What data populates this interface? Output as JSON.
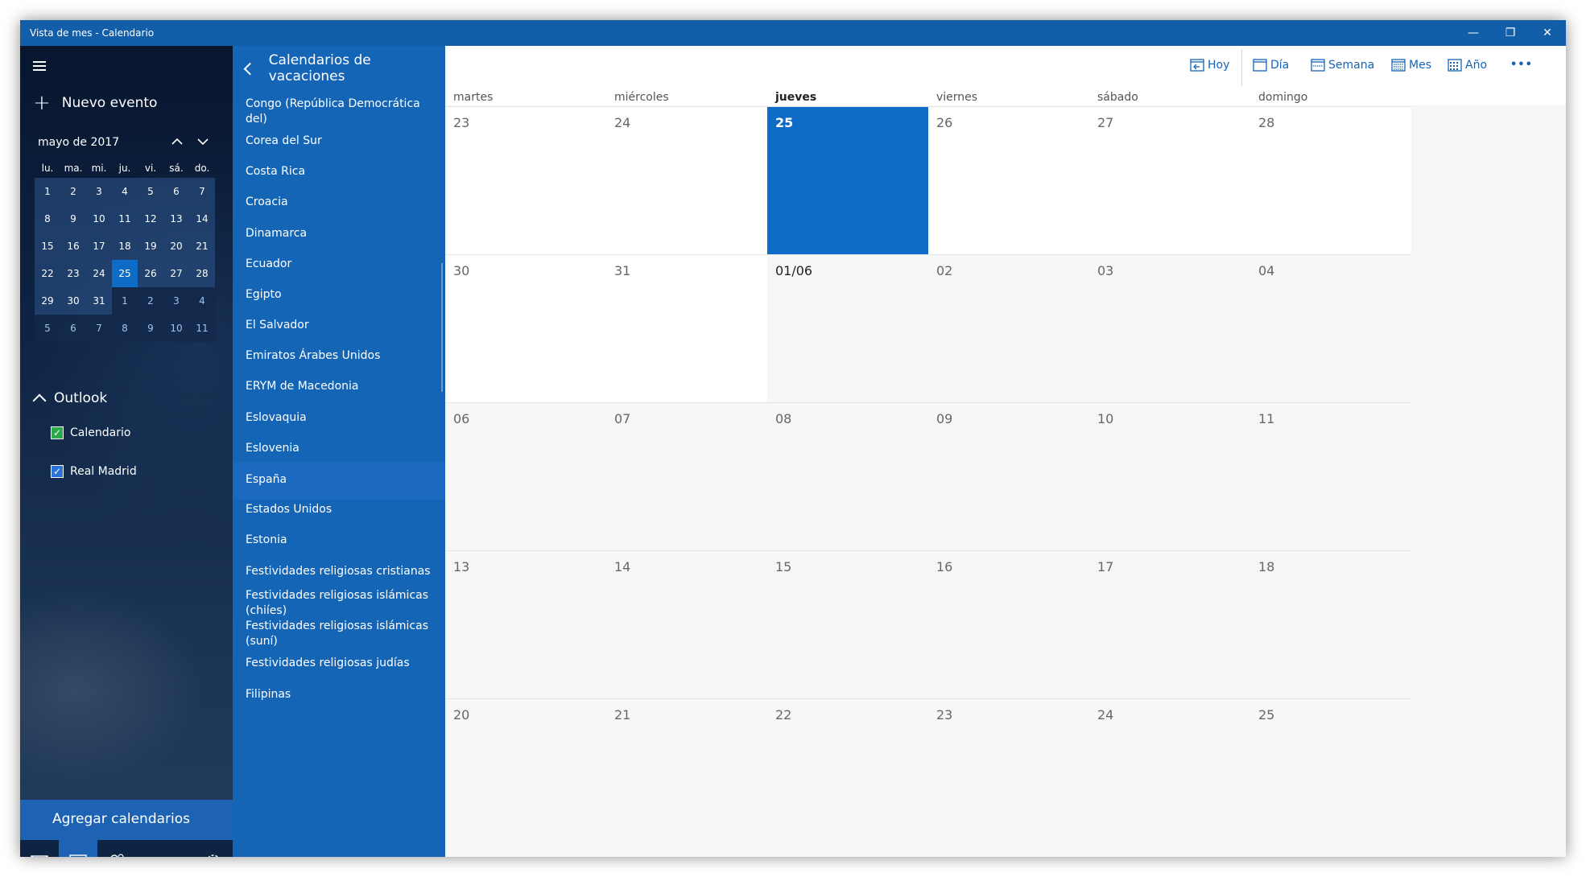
{
  "window": {
    "title": "Vista de mes - Calendario",
    "minimize": "—",
    "maximize": "❐",
    "close": "✕"
  },
  "sidebar": {
    "new_event": "Nuevo evento",
    "month_label": "mayo de 2017",
    "weekdays": [
      "lu.",
      "ma.",
      "mi.",
      "ju.",
      "vi.",
      "sá.",
      "do."
    ],
    "days": [
      [
        "1",
        "2",
        "3",
        "4",
        "5",
        "6",
        "7"
      ],
      [
        "8",
        "9",
        "10",
        "11",
        "12",
        "13",
        "14"
      ],
      [
        "15",
        "16",
        "17",
        "18",
        "19",
        "20",
        "21"
      ],
      [
        "22",
        "23",
        "24",
        "25",
        "26",
        "27",
        "28"
      ],
      [
        "29",
        "30",
        "31",
        "1",
        "2",
        "3",
        "4"
      ],
      [
        "5",
        "6",
        "7",
        "8",
        "9",
        "10",
        "11"
      ]
    ],
    "section_title": "Outlook",
    "calendars": [
      {
        "label": "Calendario",
        "color": "#2ba84a"
      },
      {
        "label": "Real Madrid",
        "color": "#2a73d9"
      }
    ],
    "add_calendars": "Agregar calendarios"
  },
  "holidays": {
    "title": "Calendarios de vacaciones",
    "items": [
      "Congo (República Democrática del)",
      "Corea del Sur",
      "Costa Rica",
      "Croacia",
      "Dinamarca",
      "Ecuador",
      "Egipto",
      "El Salvador",
      "Emiratos Árabes Unidos",
      "ERYM de Macedonia",
      "Eslovaquia",
      "Eslovenia",
      "España",
      "Estados Unidos",
      "Estonia",
      "Festividades religiosas cristianas",
      "Festividades religiosas islámicas (chiíes)",
      "Festividades religiosas islámicas (suní)",
      "Festividades religiosas judías",
      "Filipinas"
    ]
  },
  "toolbar": {
    "today": "Hoy",
    "day": "Día",
    "week": "Semana",
    "month": "Mes",
    "year": "Año",
    "more": "•••"
  },
  "month_view": {
    "weekdays": [
      "martes",
      "miércoles",
      "jueves",
      "viernes",
      "sábado",
      "domingo"
    ],
    "weeks": [
      [
        "23",
        "24",
        "25",
        "26",
        "27",
        "28"
      ],
      [
        "30",
        "31",
        "01/06",
        "02",
        "03",
        "04"
      ],
      [
        "06",
        "07",
        "08",
        "09",
        "10",
        "11"
      ],
      [
        "13",
        "14",
        "15",
        "16",
        "17",
        "18"
      ],
      [
        "20",
        "21",
        "22",
        "23",
        "24",
        "25"
      ]
    ],
    "today": "25"
  }
}
